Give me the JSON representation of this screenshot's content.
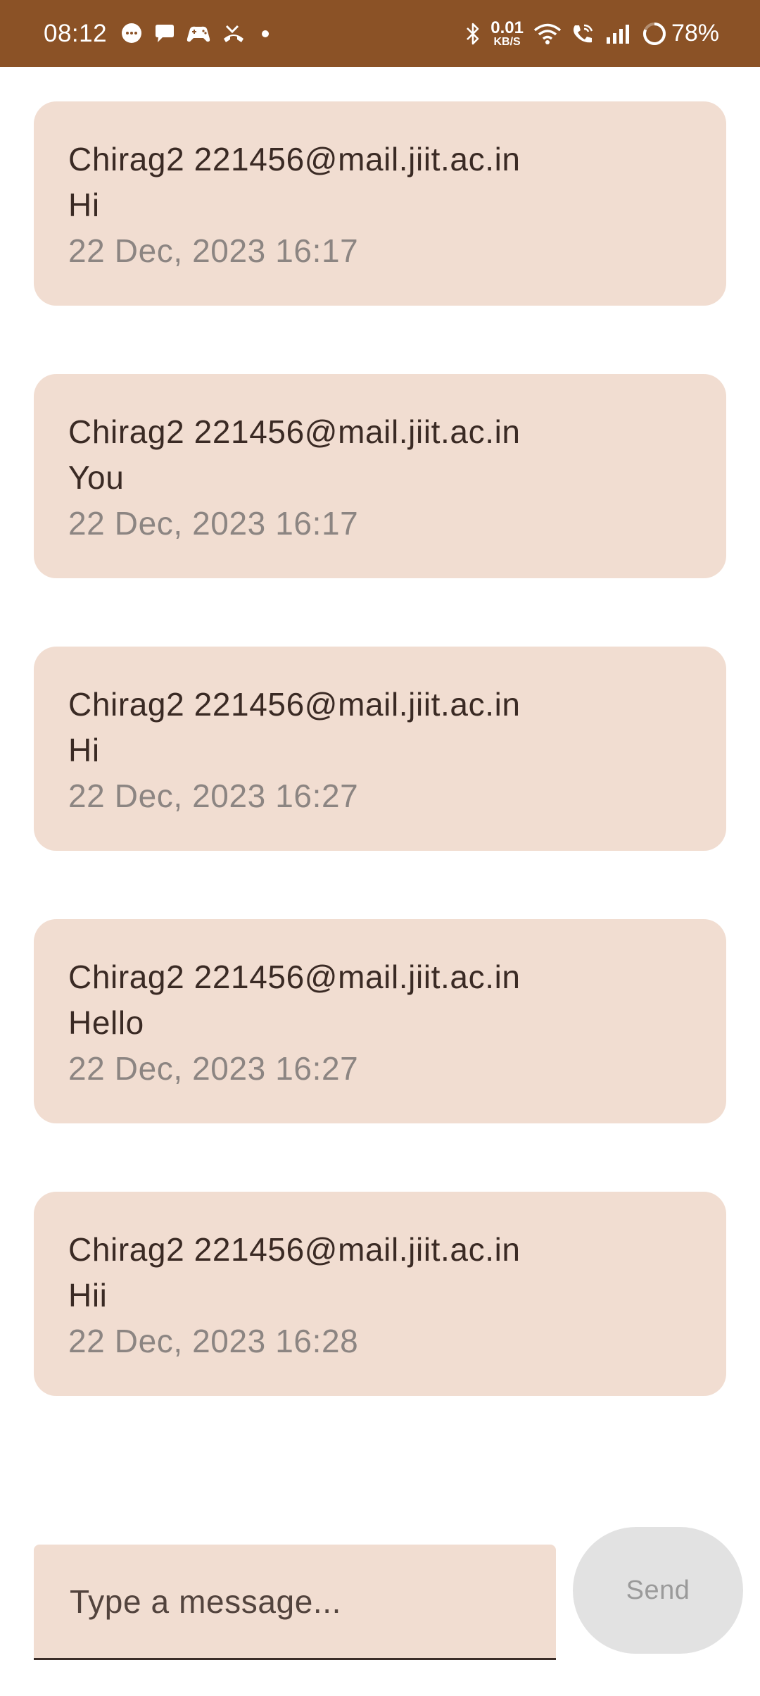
{
  "status_bar": {
    "time": "08:12",
    "net_speed_value": "0.01",
    "net_speed_unit": "KB/S",
    "battery": "78%",
    "icons": [
      "message-bubble-icon",
      "chat-icon",
      "game-controller-icon",
      "missed-call-icon",
      "dot-icon",
      "bluetooth-icon",
      "wifi-icon",
      "wifi-calling-icon",
      "signal-icon",
      "battery-ring-icon"
    ]
  },
  "messages": [
    {
      "sender": "Chirag2 221456@mail.jiit.ac.in",
      "text": "Hi",
      "timestamp": "22 Dec, 2023 16:17"
    },
    {
      "sender": "Chirag2 221456@mail.jiit.ac.in",
      "text": "You",
      "timestamp": "22 Dec, 2023 16:17"
    },
    {
      "sender": "Chirag2 221456@mail.jiit.ac.in",
      "text": "Hi",
      "timestamp": "22 Dec, 2023 16:27"
    },
    {
      "sender": "Chirag2 221456@mail.jiit.ac.in",
      "text": "Hello",
      "timestamp": "22 Dec, 2023 16:27"
    },
    {
      "sender": "Chirag2 221456@mail.jiit.ac.in",
      "text": "Hii",
      "timestamp": "22 Dec, 2023 16:28"
    }
  ],
  "composer": {
    "placeholder": "Type a message...",
    "value": "",
    "send_label": "Send"
  },
  "colors": {
    "status_bar_bg": "#8b5226",
    "card_bg": "#f1ddd1",
    "text_primary": "#3a2a24",
    "text_secondary": "#8c8582",
    "send_bg": "#e2e2e2",
    "send_text": "#9a9a9a"
  }
}
